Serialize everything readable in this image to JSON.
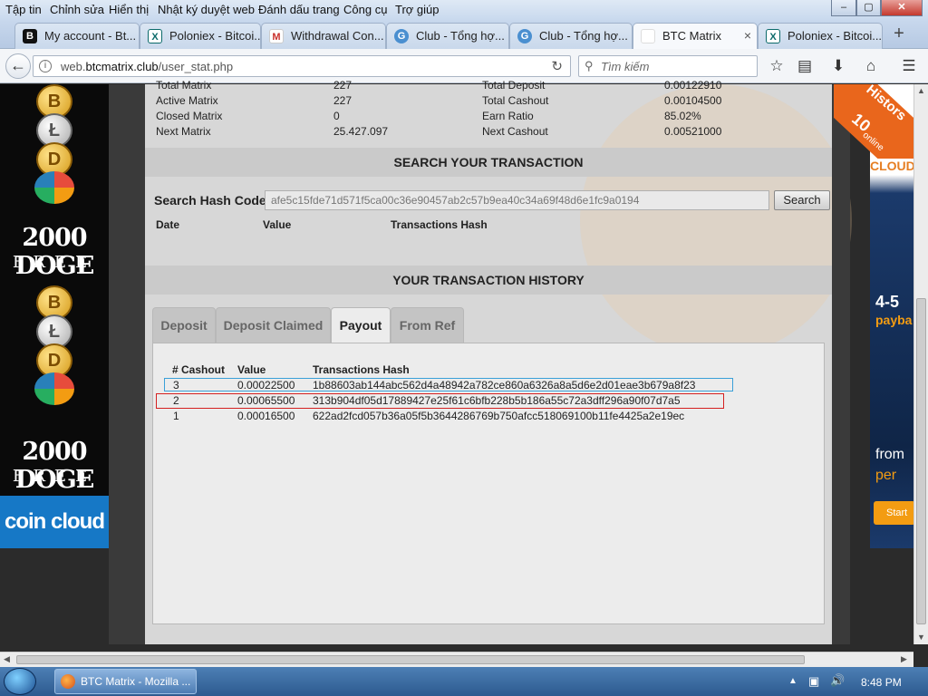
{
  "menu": [
    "Tập tin",
    "Chỉnh sửa",
    "Hiển thị",
    "Nhật ký duyệt web",
    "Đánh dấu trang",
    "Công cụ",
    "Trợ giúp"
  ],
  "window_controls": {
    "minimize": "–",
    "maximize": "▢",
    "close": "✕"
  },
  "tabs": [
    {
      "label": "My account - Bt...",
      "icon": "B"
    },
    {
      "label": "Poloniex - Bitcoi...",
      "icon": "X"
    },
    {
      "label": "Withdrawal Con...",
      "icon": "M"
    },
    {
      "label": "Club - Tổng hợ...",
      "icon": "G"
    },
    {
      "label": "Club - Tổng hợ...",
      "icon": "G"
    },
    {
      "label": "BTC Matrix",
      "icon": ""
    },
    {
      "label": "Poloniex - Bitcoi...",
      "icon": "X"
    }
  ],
  "new_tab_symbol": "+",
  "active_tab_close": "×",
  "address": {
    "prefix": "web.",
    "domain": "btcmatrix.club",
    "path": "/user_stat.php"
  },
  "search_placeholder": "Tìm kiếm",
  "ads": {
    "doge_line1": "2000 DOGE",
    "doge_line2": "FREE",
    "coincloud": "coin cloud",
    "right_text1": "4-5",
    "right_text2": "payba",
    "right_text3": "from",
    "right_text4": "per",
    "right_button": "Start",
    "right_badge_big": "10",
    "right_badge_small": "online",
    "right_cloud": "CLOUD",
    "right_history": "Histors"
  },
  "stats": {
    "left": [
      {
        "label": "Total Matrix",
        "value": "227"
      },
      {
        "label": "Active Matrix",
        "value": "227"
      },
      {
        "label": "Closed Matrix",
        "value": "0"
      },
      {
        "label": "Next Matrix",
        "value": "25.427.097"
      }
    ],
    "right": [
      {
        "label": "Total Deposit",
        "value": "0.00122910"
      },
      {
        "label": "Total Cashout",
        "value": "0.00104500"
      },
      {
        "label": "Earn Ratio",
        "value": "85.02%"
      },
      {
        "label": "Next Cashout",
        "value": "0.00521000"
      }
    ]
  },
  "search_section": {
    "title": "SEARCH YOUR TRANSACTION",
    "label": "Search Hash Code",
    "input_value": "afe5c15fde71d571f5ca00c36e90457ab2c57b9ea40c34a69f48d6e1fc9a0194",
    "button": "Search",
    "columns": [
      "Date",
      "Value",
      "Transactions Hash"
    ]
  },
  "history_section": {
    "title": "YOUR TRANSACTION HISTORY",
    "tabs": [
      "Deposit",
      "Deposit Claimed",
      "Payout",
      "From Ref"
    ],
    "active_tab": "Payout",
    "columns": [
      "# Cashout",
      "Value",
      "Transactions Hash"
    ],
    "rows": [
      {
        "n": "3",
        "value": "0.00022500",
        "hash": "1b88603ab144abc562d4a48942a782ce860a6326a8a5d6e2d01eae3b679a8f23",
        "highlight": "#3aa0d8"
      },
      {
        "n": "2",
        "value": "0.00065500",
        "hash": "313b904df05d17889427e25f61c6bfb228b5b186a55c72a3dff296a90f07d7a5",
        "highlight": "#d42020"
      },
      {
        "n": "1",
        "value": "0.00016500",
        "hash": "622ad2fcd057b36a05f5b3644286769b750afcc518069100b11fe4425a2e19ec",
        "highlight": ""
      }
    ]
  },
  "taskbar": {
    "app": "BTC Matrix - Mozilla ...",
    "time": "8:48 PM"
  }
}
